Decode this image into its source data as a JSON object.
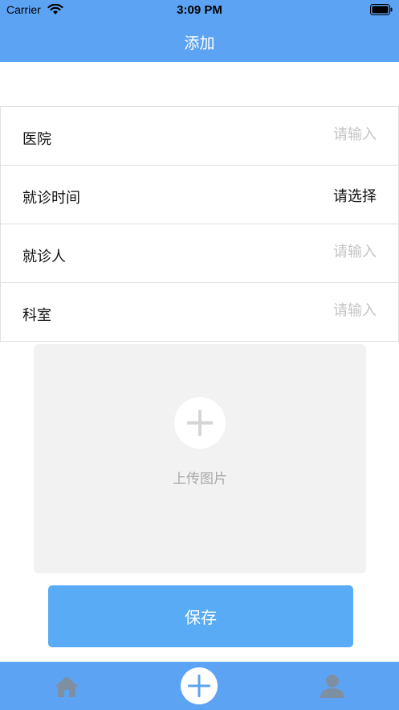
{
  "status_bar": {
    "carrier": "Carrier",
    "time": "3:09 PM"
  },
  "nav": {
    "title": "添加"
  },
  "form": {
    "rows": [
      {
        "label": "医院",
        "placeholder": "请输入",
        "kind": "input"
      },
      {
        "label": "就诊时间",
        "value": "请选择",
        "kind": "select"
      },
      {
        "label": "就诊人",
        "placeholder": "请输入",
        "kind": "input"
      },
      {
        "label": "科室",
        "placeholder": "请输入",
        "kind": "input"
      }
    ]
  },
  "upload": {
    "label": "上传图片",
    "icon": "plus-icon"
  },
  "save": {
    "label": "保存"
  },
  "tabs": {
    "home_icon": "home-icon",
    "add_icon": "plus-icon",
    "profile_icon": "user-icon"
  },
  "colors": {
    "primary": "#5da3f3",
    "button": "#58abf4",
    "upload_bg": "#f2f2f2",
    "placeholder": "#c4c4c4",
    "tab_icon": "#7f8fa3"
  }
}
